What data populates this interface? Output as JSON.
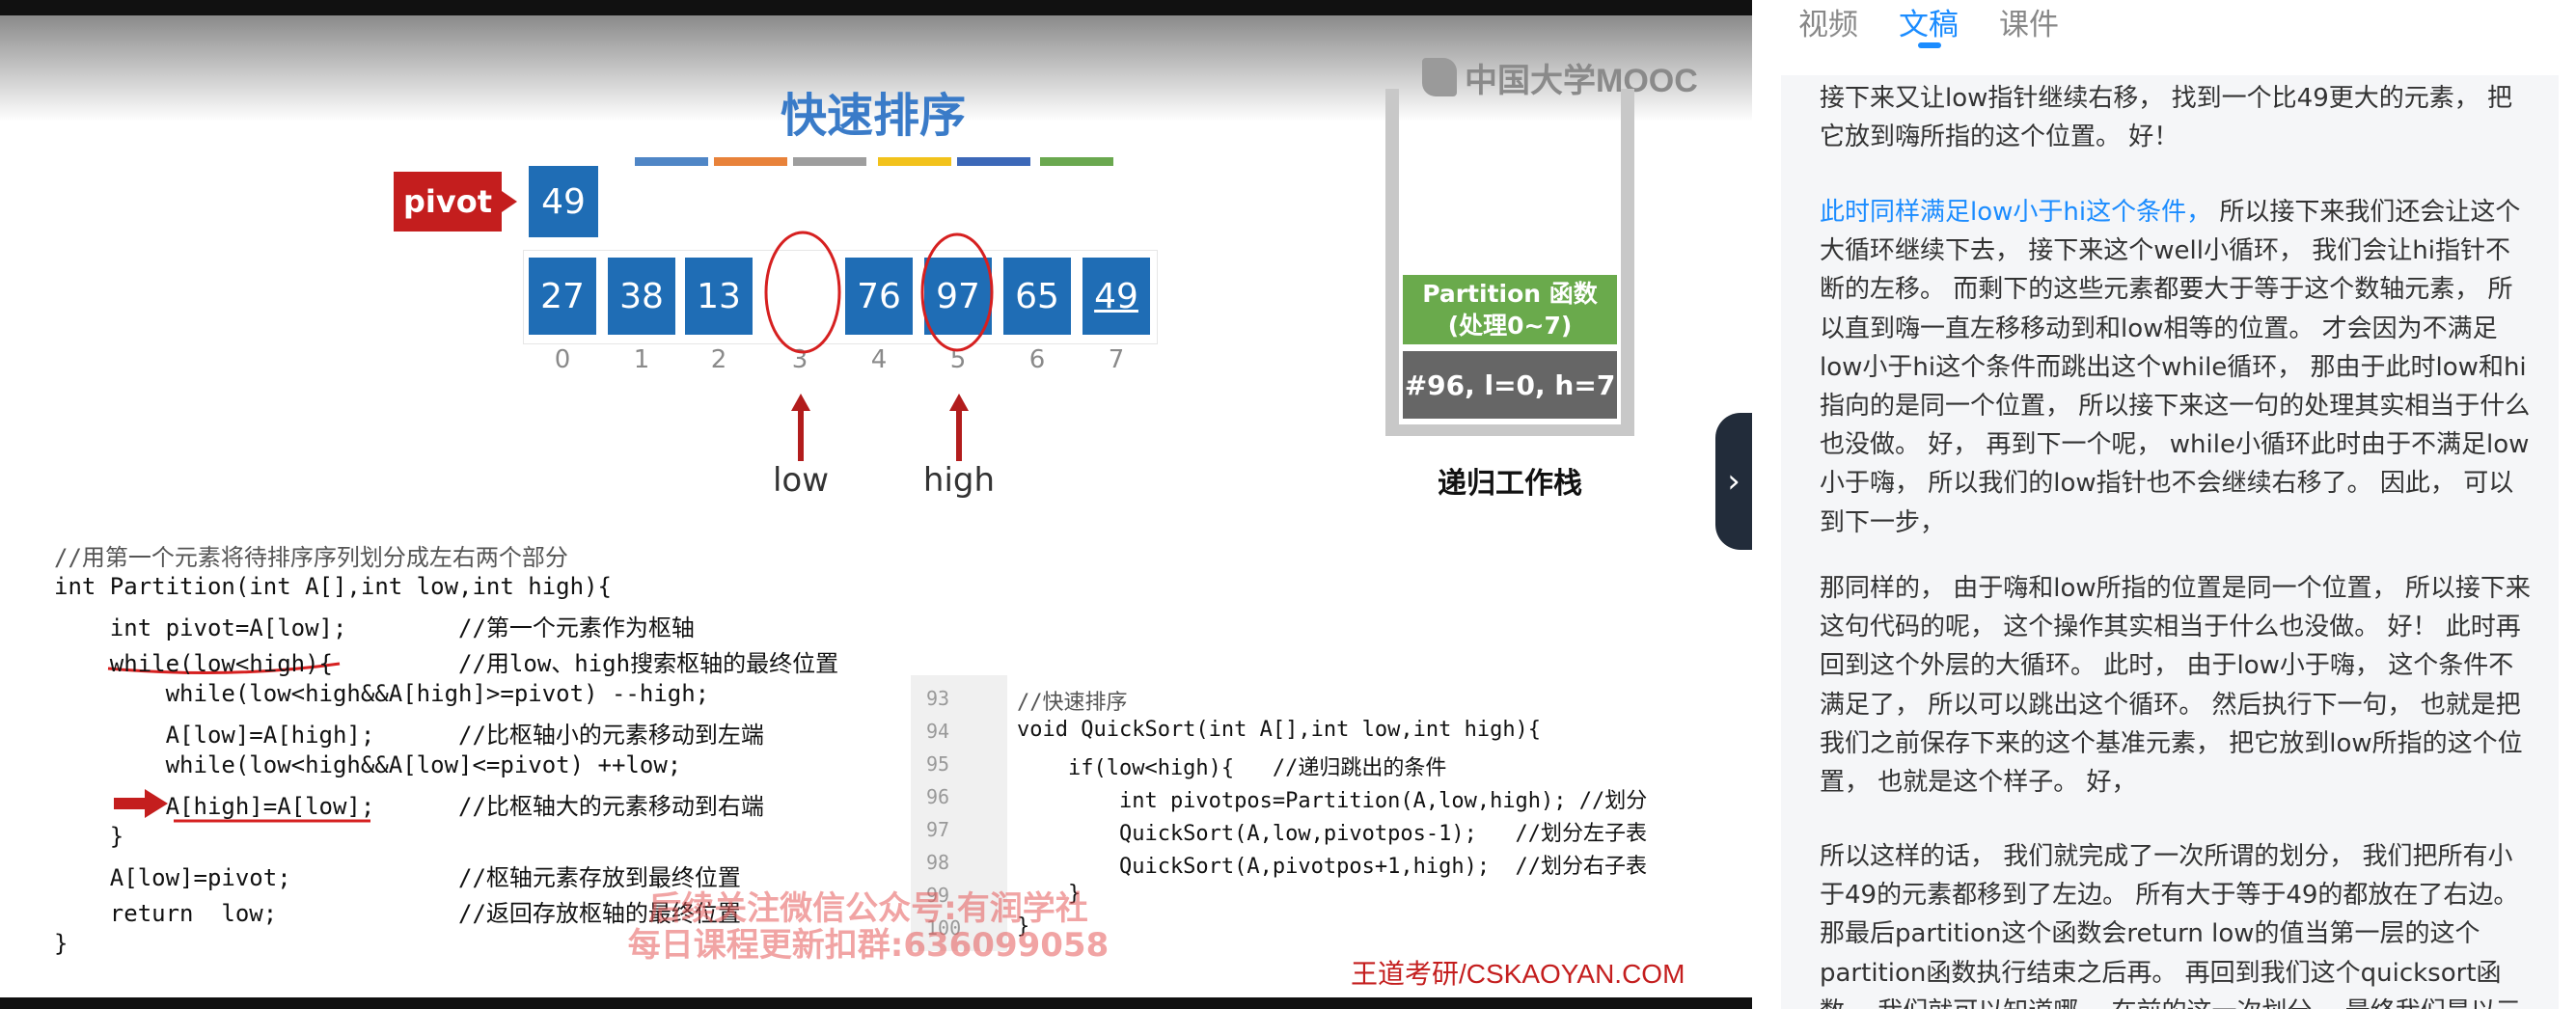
{
  "slide": {
    "title": "快速排序",
    "brand": "中国大学MOOC",
    "pivot_label": "pivot",
    "pivot_value": "49",
    "color_bars": [
      "#4f86c6",
      "#e8823a",
      "#9e9e9e",
      "#f2c21b",
      "#3c68b8",
      "#6aa84f"
    ],
    "cells": [
      "27",
      "38",
      "13",
      "",
      "76",
      "97",
      "65",
      "49"
    ],
    "indices": [
      "0",
      "1",
      "2",
      "3",
      "4",
      "5",
      "6",
      "7"
    ],
    "low_label": "low",
    "high_label": "high",
    "stack_frame_line1": "Partition 函数",
    "stack_frame_line2": "(处理0~7)",
    "stack_frame_bottom": "#96, l=0, h=7",
    "stack_title": "递归工作栈",
    "code1_comment": "//用第一个元素将待排序序列划分成左右两个部分",
    "code1": [
      "int Partition(int A[],int low,int high){",
      "    int pivot=A[low];        //第一个元素作为枢轴",
      "    while(low<high){         //用low、high搜索枢轴的最终位置",
      "        while(low<high&&A[high]>=pivot) --high;",
      "        A[low]=A[high];      //比枢轴小的元素移动到左端",
      "        while(low<high&&A[low]<=pivot) ++low;",
      "        A[high]=A[low];      //比枢轴大的元素移动到右端",
      "    }",
      "    A[low]=pivot;            //枢轴元素存放到最终位置",
      "    return  low;             //返回存放枢轴的最终位置",
      "}"
    ],
    "code2_numbers": [
      "93",
      "94",
      "95",
      "96",
      "97",
      "98",
      "99",
      "100"
    ],
    "code2": [
      "//快速排序",
      "void QuickSort(int A[],int low,int high){",
      "    if(low<high){   //递归跳出的条件",
      "        int pivotpos=Partition(A,low,high); //划分",
      "        QuickSort(A,low,pivotpos-1);   //划分左子表",
      "        QuickSort(A,pivotpos+1,high);  //划分右子表",
      "    }",
      "}"
    ],
    "watermark_line1": "后续关注微信公众号:有润学社",
    "watermark_line2": "每日课程更新扣群:636099058",
    "footer_credit": "王道考研/CSKAOYAN.COM",
    "collapse_icon": "chevron-right-icon"
  },
  "panel": {
    "tabs": [
      {
        "label": "视频",
        "active": false
      },
      {
        "label": "文稿",
        "active": true
      },
      {
        "label": "课件",
        "active": false
      }
    ],
    "accent": "#1b8cff",
    "paragraphs": [
      {
        "highlight": "",
        "text": "接下来又让low指针继续右移， 找到一个比49更大的元素， 把它放到嗨所指的这个位置。 好！"
      },
      {
        "highlight": "此时同样满足low小于hi这个条件，",
        "text": " 所以接下来我们还会让这个大循环继续下去， 接下来这个well小循环， 我们会让hi指针不断的左移。 而剩下的这些元素都要大于等于这个数轴元素， 所以直到嗨一直左移移动到和low相等的位置。 才会因为不满足low小于hi这个条件而跳出这个while循环， 那由于此时low和hi指向的是同一个位置， 所以接下来这一句的处理其实相当于什么也没做。 好， 再到下一个呢， while小循环此时由于不满足low小于嗨， 所以我们的low指针也不会继续右移了。 因此， 可以到下一步，"
      },
      {
        "highlight": "",
        "text": "那同样的， 由于嗨和low所指的位置是同一个位置， 所以接下来这句代码的呢， 这个操作其实相当于什么也没做。 好！ 此时再回到这个外层的大循环。 此时， 由于low小于嗨， 这个条件不满足了， 所以可以跳出这个循环。 然后执行下一句， 也就是把我们之前保存下来的这个基准元素， 把它放到low所指的这个位置， 也就是这个样子。 好，"
      },
      {
        "highlight": "",
        "text": "所以这样的话， 我们就完成了一次所谓的划分， 我们把所有小于49的元素都移到了左边。 所有大于等于49的都放在了右边。 那最后partition这个函数会return low的值当第一层的这个partition函数执行结束之后再。 再回到我们这个quicksort函数， 我们就可以知道哪， 在前的这一次划分， 最终我们是以三"
      }
    ]
  }
}
